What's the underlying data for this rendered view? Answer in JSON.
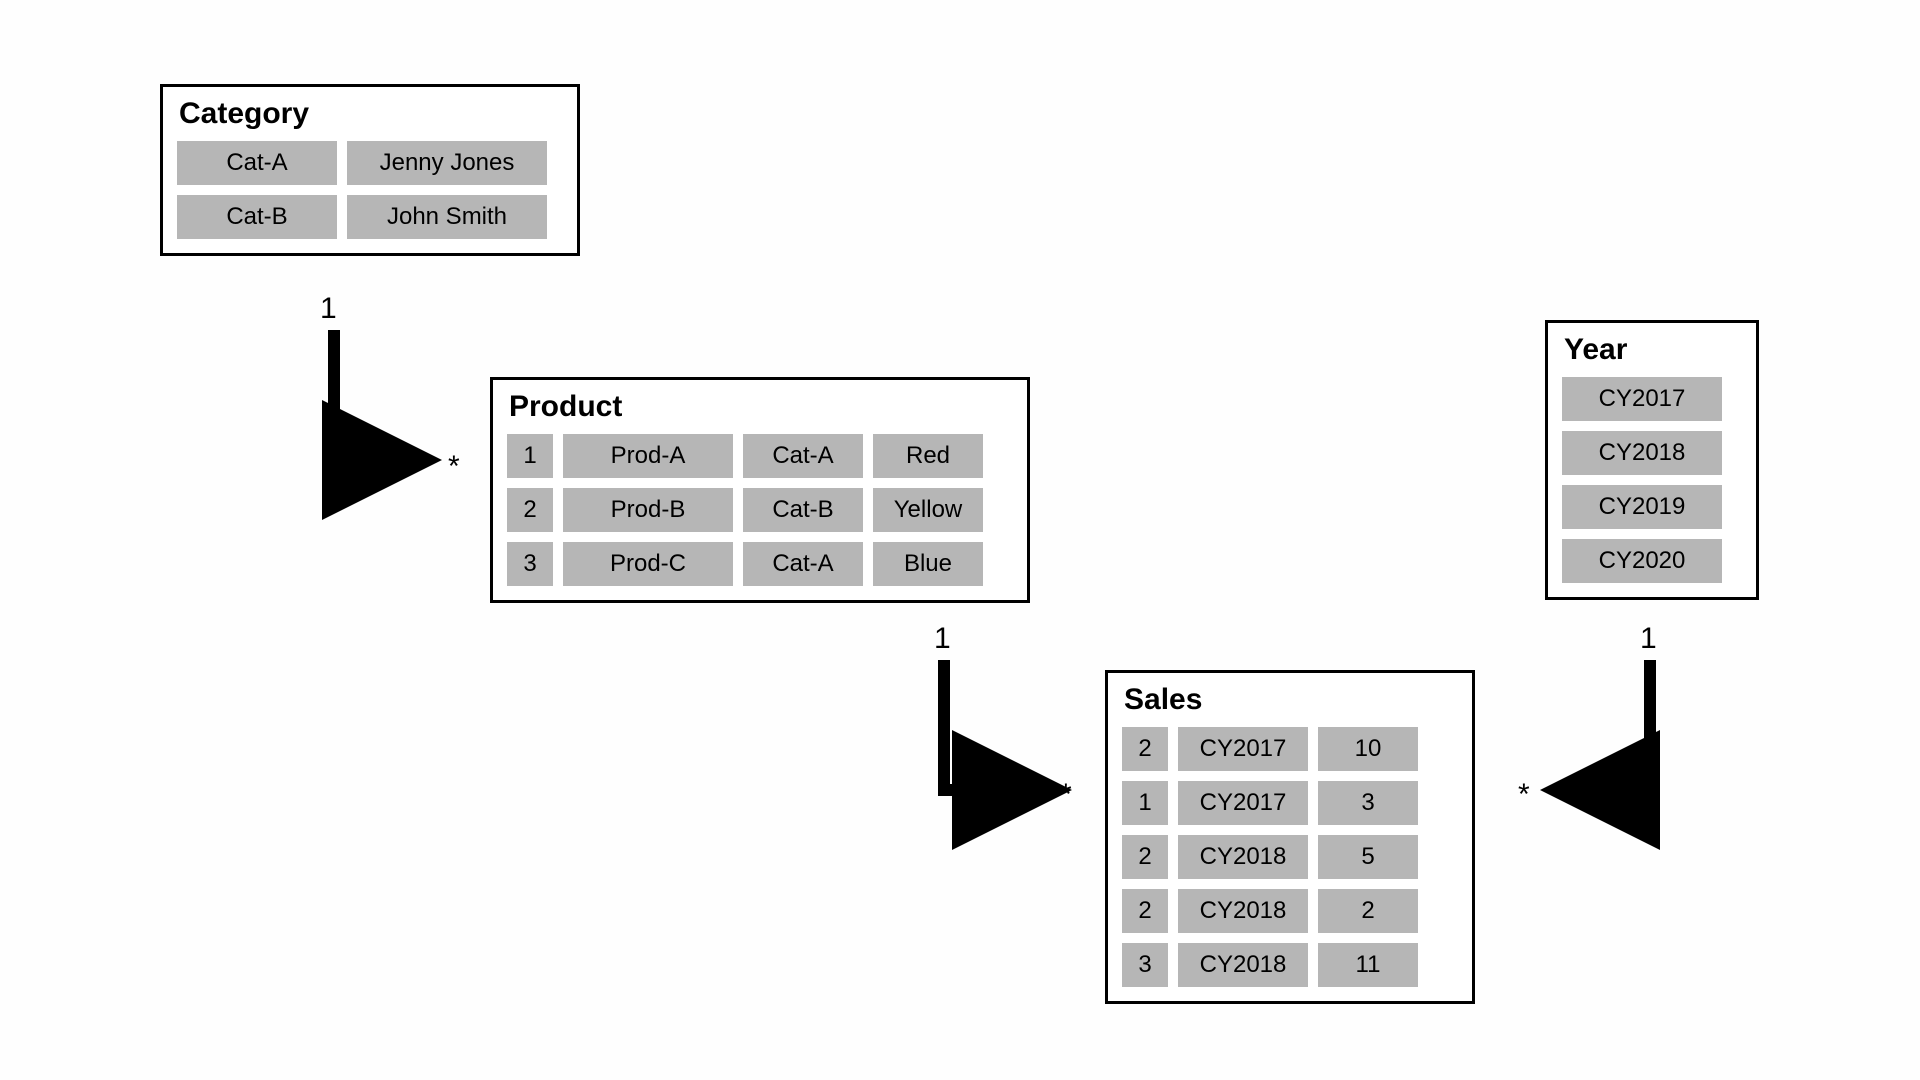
{
  "entities": {
    "category": {
      "title": "Category",
      "rows": [
        [
          "Cat-A",
          "Jenny Jones"
        ],
        [
          "Cat-B",
          "John Smith"
        ]
      ]
    },
    "product": {
      "title": "Product",
      "rows": [
        [
          "1",
          "Prod-A",
          "Cat-A",
          "Red"
        ],
        [
          "2",
          "Prod-B",
          "Cat-B",
          "Yellow"
        ],
        [
          "3",
          "Prod-C",
          "Cat-A",
          "Blue"
        ]
      ]
    },
    "sales": {
      "title": "Sales",
      "rows": [
        [
          "2",
          "CY2017",
          "10"
        ],
        [
          "1",
          "CY2017",
          "3"
        ],
        [
          "2",
          "CY2018",
          "5"
        ],
        [
          "2",
          "CY2018",
          "2"
        ],
        [
          "3",
          "CY2018",
          "11"
        ]
      ]
    },
    "year": {
      "title": "Year",
      "rows": [
        [
          "CY2017"
        ],
        [
          "CY2018"
        ],
        [
          "CY2019"
        ],
        [
          "CY2020"
        ]
      ]
    }
  },
  "cardinality": {
    "one": "1",
    "many": "*"
  }
}
